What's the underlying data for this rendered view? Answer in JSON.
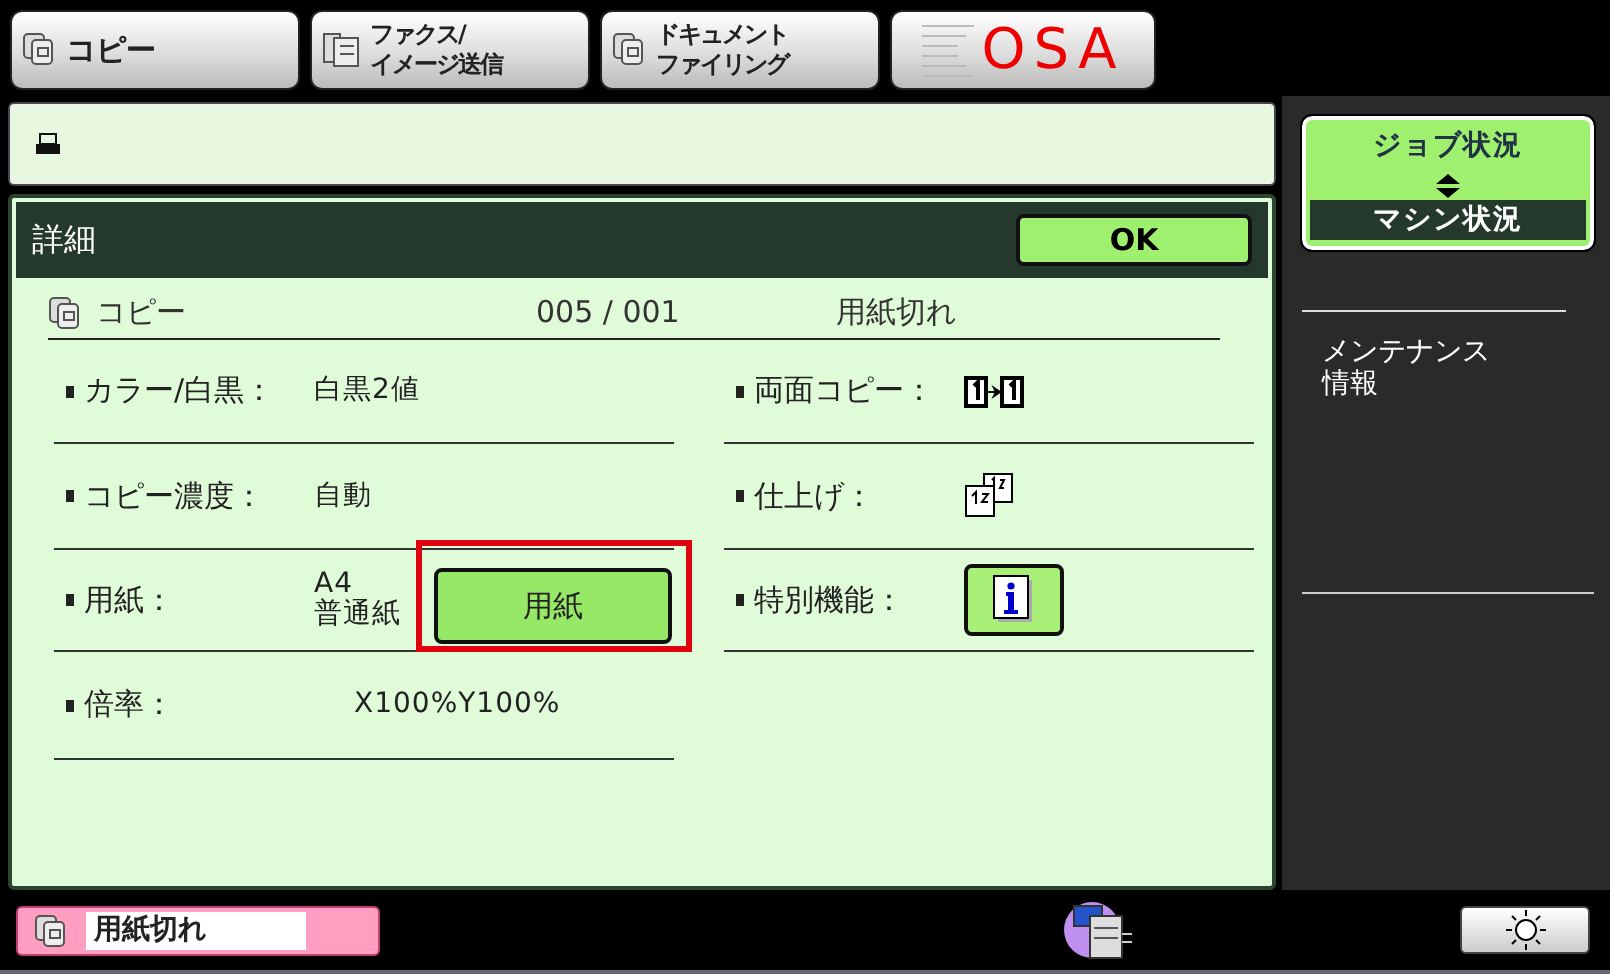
{
  "top_tabs": [
    {
      "kind": "copy",
      "lines": [
        "コピー"
      ]
    },
    {
      "kind": "fax",
      "lines": [
        "ファクス/",
        "イメージ送信"
      ]
    },
    {
      "kind": "filing",
      "lines": [
        "ドキュメント",
        "ファイリング"
      ]
    },
    {
      "kind": "logo",
      "lines": [
        "OSA"
      ]
    }
  ],
  "detail": {
    "title": "詳細",
    "ok": "OK",
    "job": {
      "name": "コピー",
      "count": "005 / 001",
      "status": "用紙切れ"
    },
    "left_settings": [
      {
        "label": "カラー/白黒：",
        "value": "白黒2値"
      },
      {
        "label": "コピー濃度：",
        "value": "自動"
      },
      {
        "label": "用紙：",
        "value": "A4\n普通紙",
        "button": "用紙",
        "highlighted": true
      },
      {
        "label": "倍率：",
        "value": "X100%Y100%"
      }
    ],
    "right_settings": [
      {
        "label": "両面コピー：",
        "kind": "duplex"
      },
      {
        "label": "仕上げ：",
        "kind": "finish"
      },
      {
        "label": "特別機能：",
        "kind": "info"
      }
    ]
  },
  "sidebar": {
    "status_toggle": [
      {
        "label": "ジョブ状況",
        "selected": false
      },
      {
        "label": "マシン状況",
        "selected": true
      }
    ],
    "maintenance": [
      "メンテナンス",
      "情報"
    ]
  },
  "status_bar": {
    "message": "用紙切れ"
  }
}
